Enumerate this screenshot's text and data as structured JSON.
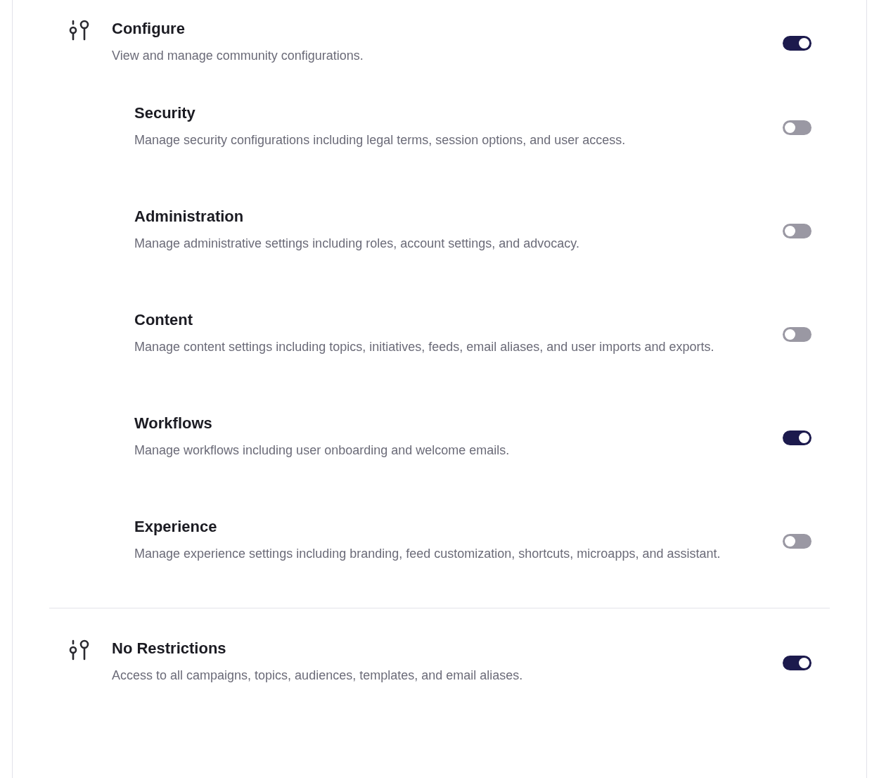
{
  "sections": [
    {
      "title": "Configure",
      "description": "View and manage community configurations.",
      "on": true,
      "children": [
        {
          "title": "Security",
          "description": "Manage security configurations including legal terms, session options, and user access.",
          "on": false
        },
        {
          "title": "Administration",
          "description": "Manage administrative settings including roles, account settings, and advocacy.",
          "on": false
        },
        {
          "title": "Content",
          "description": "Manage content settings including topics, initiatives, feeds, email aliases, and user imports and exports.",
          "on": false
        },
        {
          "title": "Workflows",
          "description": "Manage workflows including user onboarding and welcome emails.",
          "on": true
        },
        {
          "title": "Experience",
          "description": "Manage experience settings including branding, feed customization, shortcuts, microapps, and assistant.",
          "on": false
        }
      ]
    },
    {
      "title": "No Restrictions",
      "description": "Access to all campaigns, topics, audiences, templates, and email aliases.",
      "on": true
    }
  ]
}
